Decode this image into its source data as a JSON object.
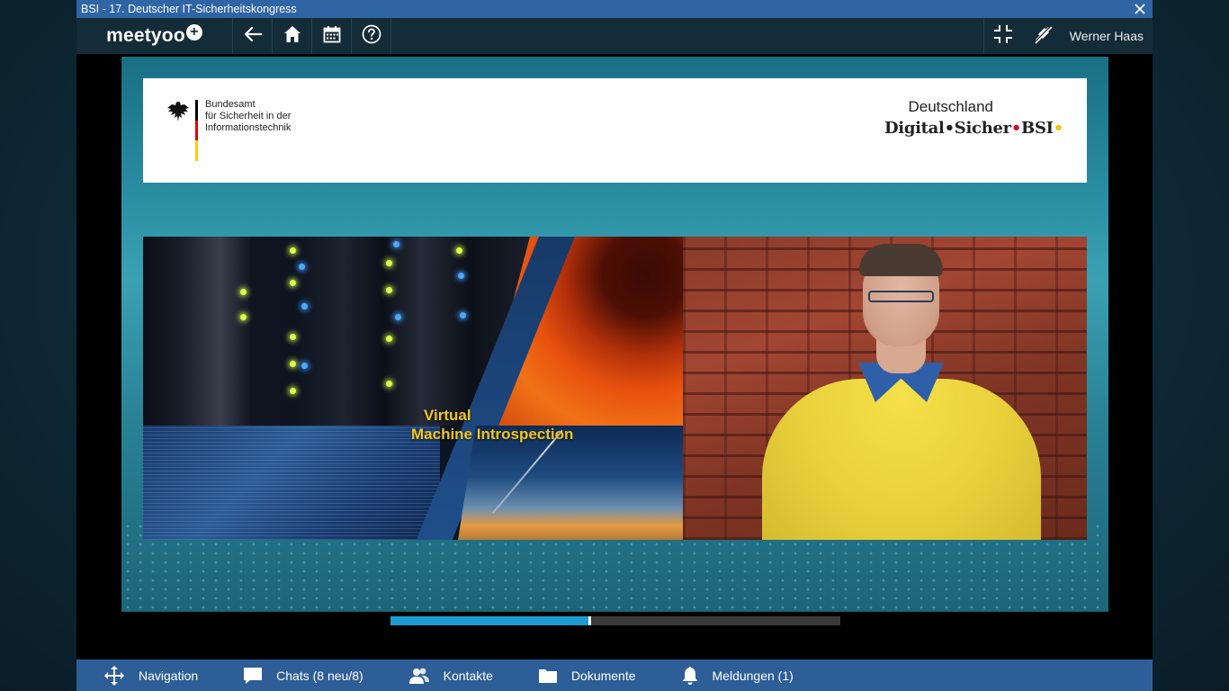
{
  "window": {
    "title": "BSI - 17. Deutscher IT-Sicherheitskongress"
  },
  "toolbar": {
    "logo_text": "meetyoo",
    "logo_badge": "+",
    "buttons": [
      "back-arrow-icon",
      "home-icon",
      "calendar-icon",
      "help-icon"
    ],
    "right_buttons": [
      "exit-fullscreen-icon",
      "mic-muted-icon"
    ],
    "user_name": "Werner Haas"
  },
  "banner": {
    "org_lines": [
      "Bundesamt",
      "für Sicherheit in der",
      "Informationstechnik"
    ],
    "right_top": "Deutschland",
    "right_part1": "Digital",
    "right_dot1": "•",
    "right_part2": "Sicher",
    "right_dot2": "•",
    "right_part3": "BSI",
    "right_dot3": "•"
  },
  "slide": {
    "title_line1": "Virtual",
    "title_line2": "Machine  Introspection"
  },
  "player": {
    "progress": 0.44
  },
  "bottom_nav": {
    "items": [
      {
        "label": "Navigation",
        "icon": "move-icon"
      },
      {
        "label": "Chats (8 neu/8)",
        "icon": "chat-icon"
      },
      {
        "label": "Kontakte",
        "icon": "contacts-icon"
      },
      {
        "label": "Dokumente",
        "icon": "folder-icon"
      },
      {
        "label": "Meldungen (1)",
        "icon": "bell-icon"
      }
    ]
  },
  "colors": {
    "titlebar": "#2f65a5",
    "toolbar": "#142c37",
    "bottombar": "#2e5e97",
    "accent": "#1e9bd0",
    "slide_title": "#f5c518"
  }
}
